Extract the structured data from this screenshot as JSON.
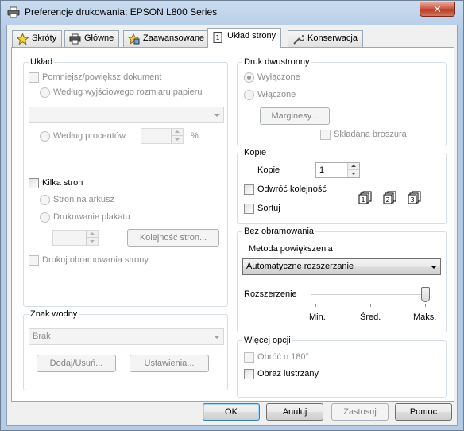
{
  "window": {
    "title": "Preferencje drukowania: EPSON L800 Series",
    "close_label": "✕"
  },
  "tabs": [
    {
      "label": "Skróty",
      "icon": "star-icon"
    },
    {
      "label": "Główne",
      "icon": "printer-icon"
    },
    {
      "label": "Zaawansowane",
      "icon": "advanced-icon"
    },
    {
      "label": "Układ strony",
      "icon": "page-layout-icon",
      "active": true
    },
    {
      "label": "Konserwacja",
      "icon": "wrench-icon"
    }
  ],
  "uklad": {
    "legend": "Układ",
    "resize_label": "Pomniejsz/powiększ dokument",
    "by_output_label": "Według wyjściowego rozmiaru papieru",
    "paper_combo_value": "",
    "by_percent_label": "Według procentów",
    "percent_value": "",
    "percent_unit": "%",
    "multi_pages_label": "Kilka stron",
    "pages_per_sheet_label": "Stron na arkusz",
    "poster_label": "Drukowanie plakatu",
    "pages_value": "",
    "page_order_button": "Kolejność stron...",
    "print_borders_label": "Drukuj obramowania strony"
  },
  "watermark": {
    "legend": "Znak wodny",
    "value": "Brak",
    "add_remove_button": "Dodaj/Usuń...",
    "settings_button": "Ustawienia..."
  },
  "duplex": {
    "legend": "Druk dwustronny",
    "off_label": "Wyłączone",
    "on_label": "Włączone",
    "margins_button": "Marginesy...",
    "booklet_label": "Składana broszura"
  },
  "copies": {
    "legend": "Kopie",
    "copies_label": "Kopie",
    "copies_value": "1",
    "reverse_label": "Odwróć kolejność",
    "collate_label": "Sortuj",
    "collate_numbers": [
      "1",
      "2",
      "3"
    ]
  },
  "borderless": {
    "legend": "Bez obramowania",
    "method_label": "Metoda powiększenia",
    "method_value": "Automatyczne rozszerzanie",
    "expansion_label": "Rozszerzenie",
    "expansion_level": "Maks.",
    "tick_min": "Min.",
    "tick_mid": "Śred.",
    "tick_max": "Maks."
  },
  "more": {
    "legend": "Więcej opcji",
    "rotate_label": "Obróć o 180°",
    "mirror_label": "Obraz lustrzany"
  },
  "footer": {
    "ok": "OK",
    "cancel": "Anuluj",
    "apply": "Zastosuj",
    "help": "Pomoc"
  }
}
